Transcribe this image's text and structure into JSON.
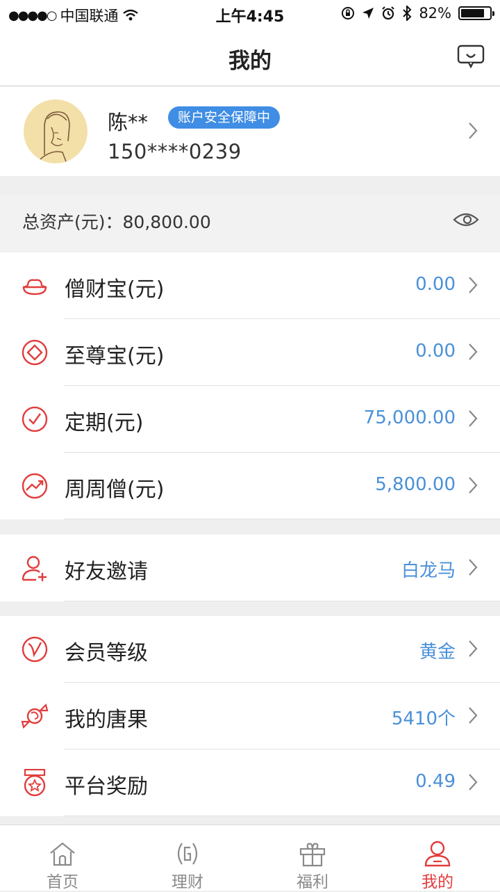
{
  "status_bar": {
    "carrier": "中国联通",
    "signal": "●●●●○",
    "time": "上午4:45",
    "battery": "82%",
    "battery_level": 0.82
  },
  "nav": {
    "title": "我的"
  },
  "profile": {
    "name": "陈**",
    "badge": "账户安全保障中",
    "phone": "150****0239"
  },
  "total_assets": {
    "label": "总资产(元)：80,800.00"
  },
  "asset_items": [
    {
      "icon": "ingot-icon",
      "label": "僧财宝(元)",
      "value": "0.00"
    },
    {
      "icon": "diamond-icon",
      "label": "至尊宝(元)",
      "value": "0.00"
    },
    {
      "icon": "clock-icon",
      "label": "定期(元)",
      "value": "75,000.00"
    },
    {
      "icon": "trend-icon",
      "label": "周周僧(元)",
      "value": "5,800.00"
    }
  ],
  "invite": {
    "icon": "add-user-icon",
    "label": "好友邀请",
    "value": "白龙马"
  },
  "member_items": [
    {
      "icon": "vip-icon",
      "label": "会员等级",
      "value": "黄金"
    },
    {
      "icon": "candy-icon",
      "label": "我的唐果",
      "value": "5410个"
    },
    {
      "icon": "medal-icon",
      "label": "平台奖励",
      "value": "0.49"
    }
  ],
  "tabs": [
    {
      "icon": "home-icon",
      "label": "首页",
      "active": false
    },
    {
      "icon": "finance-icon",
      "label": "理财",
      "active": false
    },
    {
      "icon": "gift-icon",
      "label": "福利",
      "active": false
    },
    {
      "icon": "user-icon",
      "label": "我的",
      "active": true
    }
  ],
  "colors": {
    "accent": "#e23c3c",
    "value_blue": "#4a90d9",
    "badge_blue": "#3f8de4"
  }
}
